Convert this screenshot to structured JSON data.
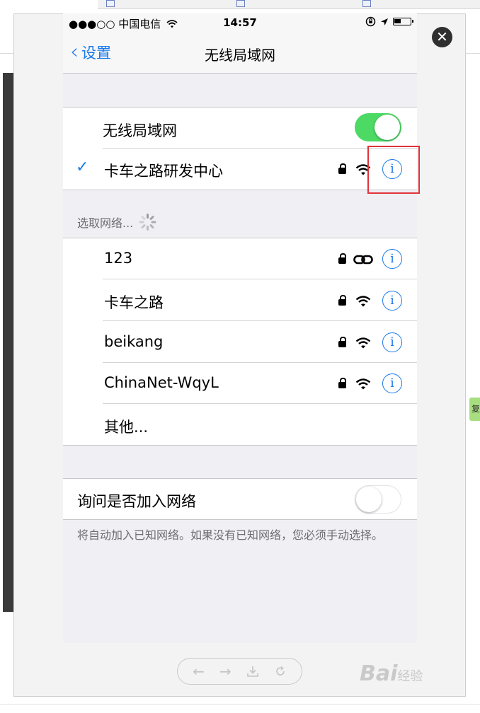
{
  "colors": {
    "accent": "#1a7ae8",
    "toggle_on": "#4cd964",
    "highlight_box": "#e0333a",
    "background": "#efeff4"
  },
  "status_bar": {
    "carrier": "●●●○○ 中国电信",
    "time": "14:57"
  },
  "nav": {
    "back_label": "设置",
    "title": "无线局域网"
  },
  "wifi_main": {
    "toggle_label": "无线局域网",
    "toggle_on": true,
    "connected_network": "卡车之路研发中心"
  },
  "networks": {
    "section_header": "选取网络...",
    "items": [
      {
        "name": "123",
        "icon": "chain-link-icon"
      },
      {
        "name": "卡车之路",
        "icon": "wifi-icon"
      },
      {
        "name": "beikang",
        "icon": "wifi-icon"
      },
      {
        "name": "ChinaNet-WqyL",
        "icon": "wifi-icon"
      }
    ],
    "other_label": "其他..."
  },
  "ask_join": {
    "label": "询问是否加入网络",
    "toggle_on": false,
    "footer": "将自动加入已知网络。如果没有已知网络，您必须手动选择。"
  },
  "overlay": {
    "close_icon": "close-icon",
    "toolbar_icons": [
      "back-arrow-icon",
      "forward-arrow-icon",
      "download-icon",
      "refresh-icon"
    ]
  },
  "background": {
    "side_tab_label": "复"
  },
  "watermark": {
    "text": "Bai",
    "suffix": "经验"
  }
}
